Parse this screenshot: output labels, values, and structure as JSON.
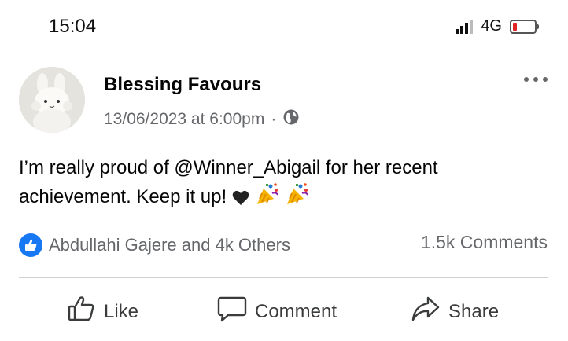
{
  "status_bar": {
    "time": "15:04",
    "network": "4G",
    "signal_icon": "cellular-signal-icon",
    "battery_icon": "battery-low-icon",
    "battery_color": "#e02424"
  },
  "post": {
    "author": "Blessing Favours",
    "timestamp": "13/06/2023 at 6:00pm",
    "separator": "·",
    "audience_icon": "globe-icon",
    "more_icon": "more-options-icon",
    "text": "I’m really proud of @Winner_Abigail for her recent achievement. Keep it up!",
    "emojis": [
      "heart-icon",
      "party-popper-icon",
      "party-popper-icon"
    ]
  },
  "engagement": {
    "reaction_icon": "like-reaction-icon",
    "reactors": "Abdullahi Gajere and 4k Others",
    "comments": "1.5k Comments"
  },
  "actions": {
    "like": "Like",
    "comment": "Comment",
    "share": "Share"
  },
  "colors": {
    "accent": "#1877f2",
    "secondary_text": "#65676b",
    "divider": "#ced0d4"
  }
}
